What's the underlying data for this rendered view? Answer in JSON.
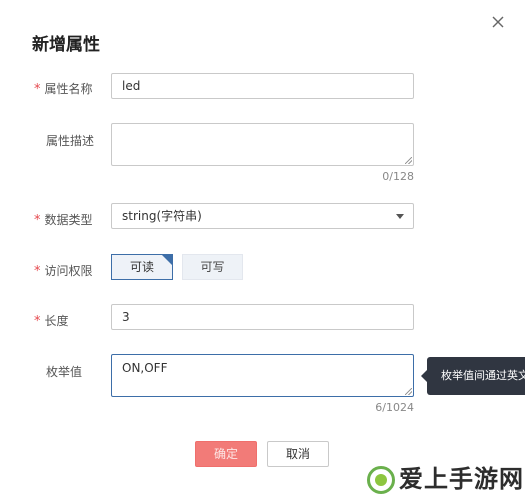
{
  "dialog": {
    "title": "新增属性",
    "close_glyph": "×"
  },
  "form": {
    "name": {
      "label": "属性名称",
      "required": true,
      "value": "led"
    },
    "description": {
      "label": "属性描述",
      "required": false,
      "value": "",
      "counter": "0/128"
    },
    "data_type": {
      "label": "数据类型",
      "required": true,
      "selected": "string(字符串)"
    },
    "access": {
      "label": "访问权限",
      "required": true,
      "options": [
        "可读",
        "可写"
      ],
      "selected_index": 0
    },
    "length": {
      "label": "长度",
      "required": true,
      "value": "3"
    },
    "enum_values": {
      "label": "枚举值",
      "required": false,
      "value": "ON,OFF",
      "counter": "6/1024"
    }
  },
  "tooltip": {
    "text": "枚举值间通过英文"
  },
  "buttons": {
    "ok": "确定",
    "cancel": "取消"
  },
  "watermark": {
    "text": "爱上手游网"
  },
  "colors": {
    "required_star": "#e5484d",
    "accent_border": "#3d6ea8",
    "ok_button": "#f27b78",
    "tooltip_bg": "#303641"
  },
  "icons": {
    "close": "close-icon",
    "select_caret": "chevron-down-icon",
    "selected_corner": "checkmark-corner-icon",
    "resize": "resize-grip-icon"
  }
}
